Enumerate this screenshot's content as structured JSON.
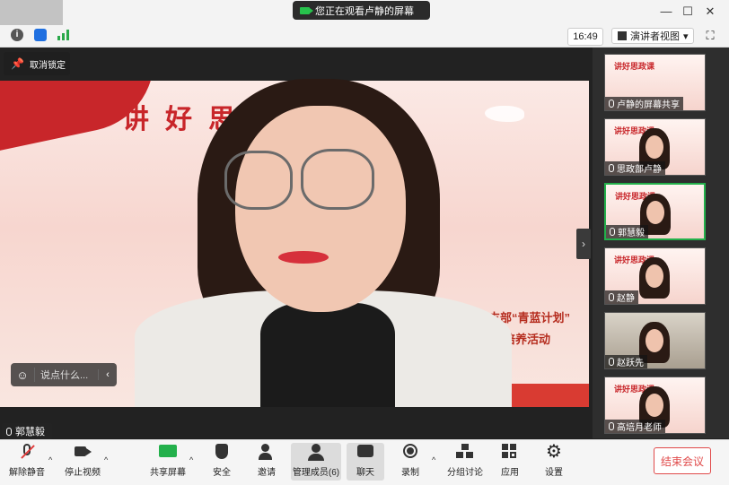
{
  "banner": {
    "text": "您正在观看卢静的屏幕"
  },
  "window": {
    "minimize": "—",
    "maximize": "☐",
    "close": "✕"
  },
  "infobar": {
    "clock": "16:49",
    "view_label": "演讲者视图",
    "view_caret": "▾"
  },
  "stage": {
    "unpin_label": "取消锁定",
    "slide_title": "讲好思政课",
    "slide_line1": "支部“青蓝计划”",
    "slide_line2": "师培养活动",
    "chat_placeholder": "说点什么...",
    "chat_arrow": "‹",
    "speaker_name": "郭慧毅",
    "collapse_arrow": "›"
  },
  "gallery": {
    "tiles": [
      {
        "name": "卢静的屏幕共享",
        "title": "讲好思政课"
      },
      {
        "name": "思政部卢静",
        "title": "讲好思政课"
      },
      {
        "name": "郭慧毅",
        "title": "讲好思政课"
      },
      {
        "name": "赵静",
        "title": "讲好思政课"
      },
      {
        "name": "赵跃先",
        "title": ""
      },
      {
        "name": "高培月老师",
        "title": "讲好思政课"
      }
    ]
  },
  "toolbar": {
    "unmute": "解除静音",
    "stop_video": "停止视频",
    "share_screen": "共享屏幕",
    "security": "安全",
    "invite": "邀请",
    "participants": "管理成员(6)",
    "chat": "聊天",
    "record": "录制",
    "breakout": "分组讨论",
    "apps": "应用",
    "settings": "设置",
    "end_meeting": "结束会议",
    "caret": "^"
  },
  "colors": {
    "accent_green": "#23b04b",
    "end_red": "#e04a4a",
    "slide_red": "#c8262a"
  }
}
